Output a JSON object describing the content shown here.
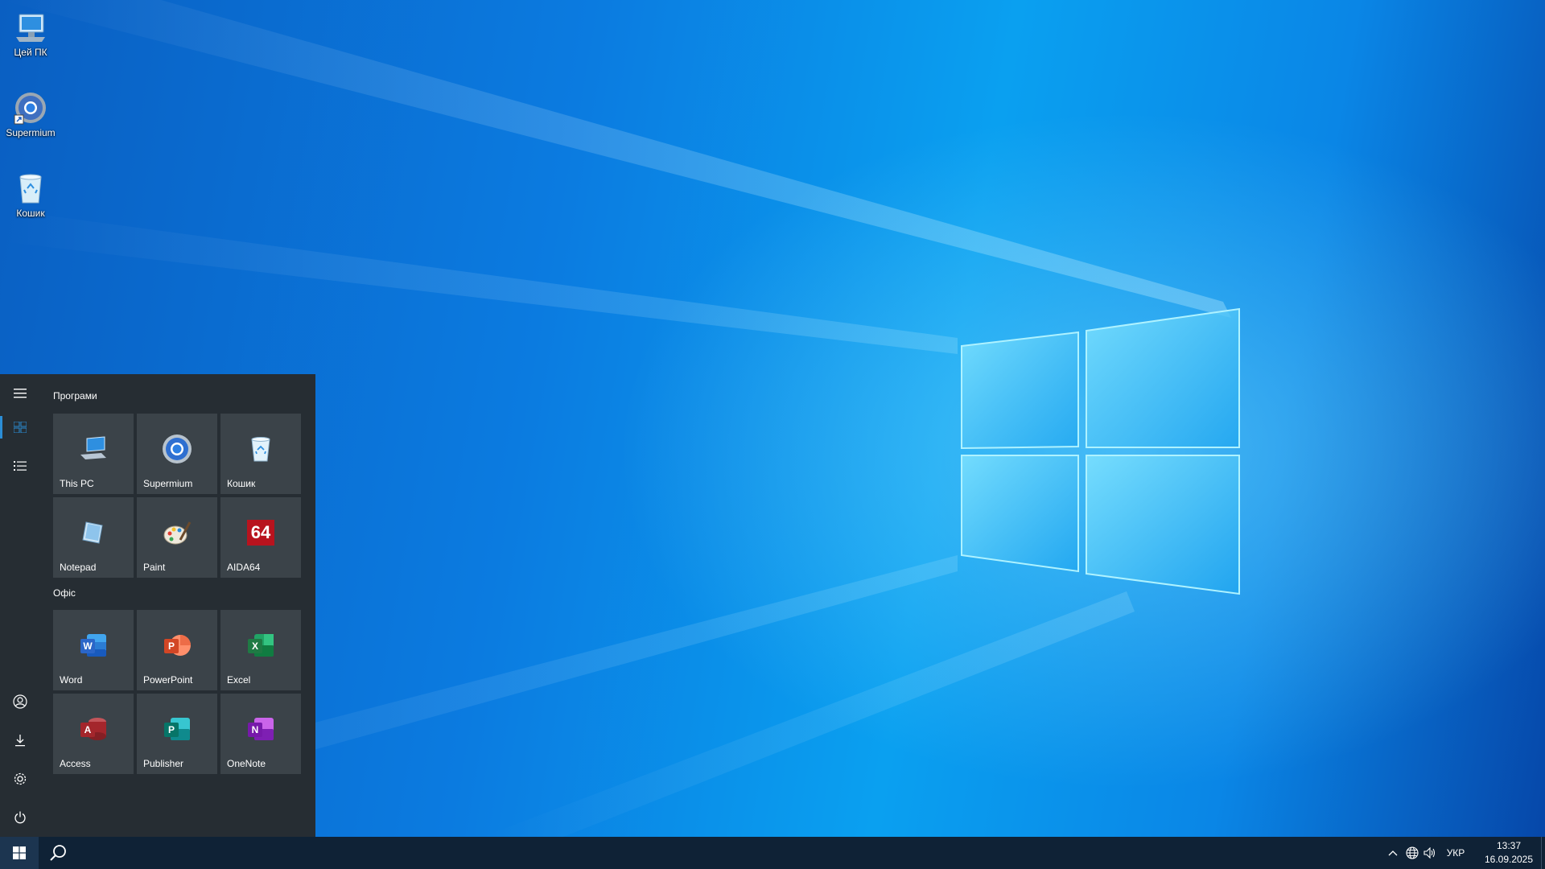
{
  "desktop": {
    "icons": [
      {
        "label": "Цей ПК",
        "icon": "computer-icon"
      },
      {
        "label": "Supermium",
        "icon": "supermium-icon"
      },
      {
        "label": "Кошик",
        "icon": "recycle-bin-icon"
      }
    ],
    "wallpaper": "windows-10-hero"
  },
  "start_menu": {
    "rail": [
      "hamburger-icon",
      "tiles-icon",
      "all-apps-list-icon",
      "user-icon",
      "downloads-icon",
      "settings-icon",
      "power-icon"
    ],
    "groups": [
      {
        "title": "Програми",
        "tiles": [
          {
            "label": "This PC",
            "icon": "computer-icon"
          },
          {
            "label": "Supermium",
            "icon": "supermium-icon"
          },
          {
            "label": "Кошик",
            "icon": "recycle-bin-icon"
          },
          {
            "label": "Notepad",
            "icon": "notepad-icon"
          },
          {
            "label": "Paint",
            "icon": "paint-icon"
          },
          {
            "label": "AIDA64",
            "icon": "aida64-icon",
            "icon_text": "64"
          }
        ]
      },
      {
        "title": "Офіс",
        "tiles": [
          {
            "label": "Word",
            "icon": "word-icon",
            "letter": "W",
            "color": "#2b66c8"
          },
          {
            "label": "PowerPoint",
            "icon": "powerpoint-icon",
            "letter": "P",
            "color": "#d24625"
          },
          {
            "label": "Excel",
            "icon": "excel-icon",
            "letter": "X",
            "color": "#1f7a44"
          },
          {
            "label": "Access",
            "icon": "access-icon",
            "letter": "A",
            "color": "#a4262c"
          },
          {
            "label": "Publisher",
            "icon": "publisher-icon",
            "letter": "P",
            "color": "#077568"
          },
          {
            "label": "OneNote",
            "icon": "onenote-icon",
            "letter": "N",
            "color": "#7719aa"
          }
        ]
      }
    ]
  },
  "taskbar": {
    "language": "УКР",
    "time": "13:37",
    "date": "16.09.2025"
  },
  "colors": {
    "start_bg": "#262d33",
    "tile_bg": "#3b4349",
    "accent": "#2b8dd6",
    "taskbar_bg": "#0f2236"
  }
}
